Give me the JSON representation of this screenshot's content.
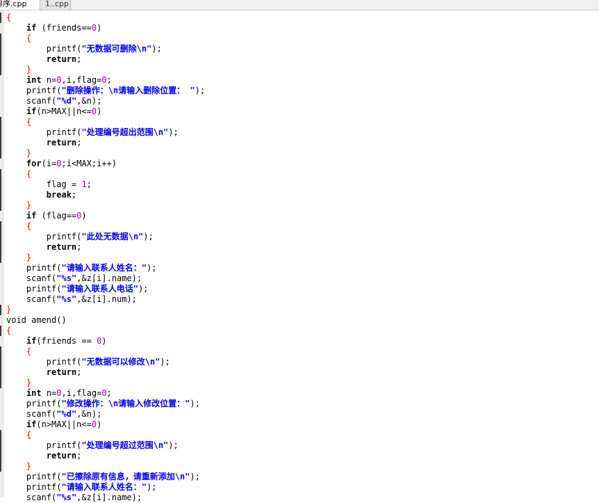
{
  "tabs": [
    {
      "label": "排序.cpp",
      "active": true
    },
    {
      "label": "1..cpp",
      "active": false
    }
  ],
  "colors": {
    "keyword": "#000000",
    "brace": "#ff0000",
    "number": "#a000a0",
    "string": "#0000ff"
  },
  "code_lines": [
    [
      [
        "br",
        "{"
      ]
    ],
    [
      [
        "t",
        "    "
      ],
      [
        "kw",
        "if"
      ],
      [
        "t",
        " ("
      ],
      [
        "t",
        "friends"
      ],
      [
        "op",
        "=="
      ],
      [
        "num",
        "0"
      ],
      [
        "t",
        ")"
      ]
    ],
    [
      [
        "t",
        "    "
      ],
      [
        "br",
        "{"
      ]
    ],
    [
      [
        "t",
        "        "
      ],
      [
        "t",
        "printf("
      ],
      [
        "str",
        "\"无数据可删除\\n\""
      ],
      [
        "t",
        ");"
      ]
    ],
    [
      [
        "t",
        "        "
      ],
      [
        "kw",
        "return"
      ],
      [
        "t",
        ";"
      ]
    ],
    [
      [
        "t",
        "    "
      ],
      [
        "br",
        "}"
      ]
    ],
    [
      [
        "t",
        "    "
      ],
      [
        "kw",
        "int"
      ],
      [
        "t",
        " n="
      ],
      [
        "num",
        "0"
      ],
      [
        "t",
        ",i,flag="
      ],
      [
        "num",
        "0"
      ],
      [
        "t",
        ";"
      ]
    ],
    [
      [
        "t",
        "    "
      ],
      [
        "t",
        "printf("
      ],
      [
        "str",
        "\"删除操作：\\n请输入删除位置： \""
      ],
      [
        "t",
        ");"
      ]
    ],
    [
      [
        "t",
        "    "
      ],
      [
        "t",
        "scanf("
      ],
      [
        "str",
        "\"%d\""
      ],
      [
        "t",
        ",&n);"
      ]
    ],
    [
      [
        "t",
        "    "
      ],
      [
        "kw",
        "if"
      ],
      [
        "t",
        "(n>MAX||n<="
      ],
      [
        "num",
        "0"
      ],
      [
        "t",
        ")"
      ]
    ],
    [
      [
        "t",
        "    "
      ],
      [
        "br",
        "{"
      ]
    ],
    [
      [
        "t",
        "        "
      ],
      [
        "t",
        "printf("
      ],
      [
        "str",
        "\"处理编号超出范围\\n\""
      ],
      [
        "t",
        ");"
      ]
    ],
    [
      [
        "t",
        "        "
      ],
      [
        "kw",
        "return"
      ],
      [
        "t",
        ";"
      ]
    ],
    [
      [
        "t",
        "    "
      ],
      [
        "br",
        "}"
      ]
    ],
    [
      [
        "t",
        "    "
      ],
      [
        "kw",
        "for"
      ],
      [
        "t",
        "(i="
      ],
      [
        "num",
        "0"
      ],
      [
        "t",
        ";i<MAX;i++)"
      ]
    ],
    [
      [
        "t",
        "    "
      ],
      [
        "br",
        "{"
      ]
    ],
    [
      [
        "t",
        "        "
      ],
      [
        "t",
        "flag = "
      ],
      [
        "num",
        "1"
      ],
      [
        "t",
        ";"
      ]
    ],
    [
      [
        "t",
        "        "
      ],
      [
        "kw",
        "break"
      ],
      [
        "t",
        ";"
      ]
    ],
    [
      [
        "t",
        "    "
      ],
      [
        "br",
        "}"
      ]
    ],
    [
      [
        "t",
        "    "
      ],
      [
        "kw",
        "if"
      ],
      [
        "t",
        " (flag=="
      ],
      [
        "num",
        "0"
      ],
      [
        "t",
        ")"
      ]
    ],
    [
      [
        "t",
        "    "
      ],
      [
        "br",
        "{"
      ]
    ],
    [
      [
        "t",
        "        "
      ],
      [
        "t",
        "printf("
      ],
      [
        "str",
        "\"此处无数据\\n\""
      ],
      [
        "t",
        ");"
      ]
    ],
    [
      [
        "t",
        "        "
      ],
      [
        "kw",
        "return"
      ],
      [
        "t",
        ";"
      ]
    ],
    [
      [
        "t",
        "    "
      ],
      [
        "br",
        "}"
      ]
    ],
    [
      [
        "t",
        "    "
      ],
      [
        "t",
        "printf("
      ],
      [
        "str",
        "\"请输入联系人姓名：\""
      ],
      [
        "t",
        ");"
      ]
    ],
    [
      [
        "t",
        "    "
      ],
      [
        "t",
        "scanf("
      ],
      [
        "str",
        "\"%s\""
      ],
      [
        "t",
        ",&z[i].name);"
      ]
    ],
    [
      [
        "t",
        "    "
      ],
      [
        "t",
        "printf("
      ],
      [
        "str",
        "\"请输入联系人电话\""
      ],
      [
        "t",
        ");"
      ]
    ],
    [
      [
        "t",
        "    "
      ],
      [
        "t",
        "scanf("
      ],
      [
        "str",
        "\"%s\""
      ],
      [
        "t",
        ",&z[i].num);"
      ]
    ],
    [
      [
        "br",
        "}"
      ]
    ],
    [
      [
        "t",
        "void amend()"
      ]
    ],
    [
      [
        "br",
        "{"
      ]
    ],
    [
      [
        "t",
        "    "
      ],
      [
        "kw",
        "if"
      ],
      [
        "t",
        "(friends == "
      ],
      [
        "num",
        "0"
      ],
      [
        "t",
        ")"
      ]
    ],
    [
      [
        "t",
        "    "
      ],
      [
        "br",
        "{"
      ]
    ],
    [
      [
        "t",
        "        "
      ],
      [
        "t",
        "printf("
      ],
      [
        "str",
        "\"无数据可以修改\\n\""
      ],
      [
        "t",
        ");"
      ]
    ],
    [
      [
        "t",
        "        "
      ],
      [
        "kw",
        "return"
      ],
      [
        "t",
        ";"
      ]
    ],
    [
      [
        "t",
        "    "
      ],
      [
        "br",
        "}"
      ]
    ],
    [
      [
        "t",
        "    "
      ],
      [
        "kw",
        "int"
      ],
      [
        "t",
        " n="
      ],
      [
        "num",
        "0"
      ],
      [
        "t",
        ",i,flag="
      ],
      [
        "num",
        "0"
      ],
      [
        "t",
        ";"
      ]
    ],
    [
      [
        "t",
        "    "
      ],
      [
        "t",
        "printf("
      ],
      [
        "str",
        "\"修改操作：\\n请输入修改位置：\""
      ],
      [
        "t",
        ");"
      ]
    ],
    [
      [
        "t",
        "    "
      ],
      [
        "t",
        "scanf("
      ],
      [
        "str",
        "\"%d\""
      ],
      [
        "t",
        ",&n);"
      ]
    ],
    [
      [
        "t",
        "    "
      ],
      [
        "kw",
        "if"
      ],
      [
        "t",
        "(n>MAX||n<="
      ],
      [
        "num",
        "0"
      ],
      [
        "t",
        ")"
      ]
    ],
    [
      [
        "t",
        "    "
      ],
      [
        "br",
        "{"
      ]
    ],
    [
      [
        "t",
        "        "
      ],
      [
        "t",
        "printf("
      ],
      [
        "str",
        "\"处理编号超过范围\\n\""
      ],
      [
        "t",
        ");"
      ]
    ],
    [
      [
        "t",
        "        "
      ],
      [
        "kw",
        "return"
      ],
      [
        "t",
        ";"
      ]
    ],
    [
      [
        "t",
        "    "
      ],
      [
        "br",
        "}"
      ]
    ],
    [
      [
        "t",
        "    "
      ],
      [
        "t",
        "printf("
      ],
      [
        "str",
        "\"已擦除原有信息，请重新添加\\n\""
      ],
      [
        "t",
        ");"
      ]
    ],
    [
      [
        "t",
        "    "
      ],
      [
        "t",
        "printf("
      ],
      [
        "str",
        "\"请输入联系人姓名：\""
      ],
      [
        "t",
        ");"
      ]
    ],
    [
      [
        "t",
        "    "
      ],
      [
        "t",
        "scanf("
      ],
      [
        "str",
        "\"%s\""
      ],
      [
        "t",
        ",&z[i].name);"
      ]
    ]
  ]
}
